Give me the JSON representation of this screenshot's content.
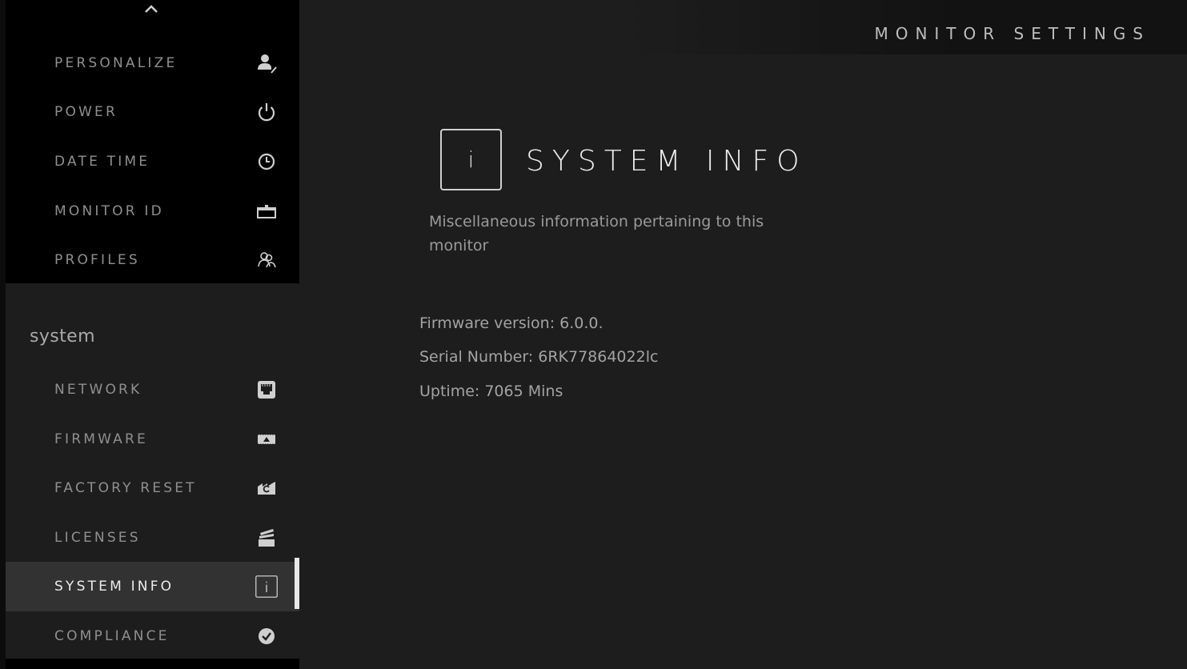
{
  "header": {
    "title": "MONITOR SETTINGS"
  },
  "sidebar": {
    "top_items": [
      {
        "label": "PERSONALIZE",
        "icon": "person-edit-icon"
      },
      {
        "label": "POWER",
        "icon": "power-icon"
      },
      {
        "label": "DATE TIME",
        "icon": "clock-icon"
      },
      {
        "label": "MONITOR ID",
        "icon": "id-tag-icon"
      },
      {
        "label": "PROFILES",
        "icon": "profiles-icon"
      }
    ],
    "section_heading": "system",
    "system_items": [
      {
        "label": "NETWORK",
        "icon": "ethernet-port-icon"
      },
      {
        "label": "FIRMWARE",
        "icon": "chip-icon"
      },
      {
        "label": "FACTORY RESET",
        "icon": "factory-reset-icon"
      },
      {
        "label": "LICENSES",
        "icon": "cards-icon"
      },
      {
        "label": "SYSTEM INFO",
        "icon": "info-icon",
        "active": true
      },
      {
        "label": "COMPLIANCE",
        "icon": "check-circle-icon"
      }
    ]
  },
  "main": {
    "icon_glyph": "i",
    "title": "SYSTEM INFO",
    "description": "Miscellaneous information pertaining to this monitor",
    "info": {
      "firmware": "Firmware version: 6.0.0.",
      "serial": "Serial Number: 6RK77864022lc",
      "uptime": "Uptime: 7065 Mins"
    }
  },
  "colors": {
    "background": "#1d1d1d",
    "sidebar_top": "#000000",
    "active_item": "#323232",
    "selection_bar": "#e8e8e8"
  }
}
